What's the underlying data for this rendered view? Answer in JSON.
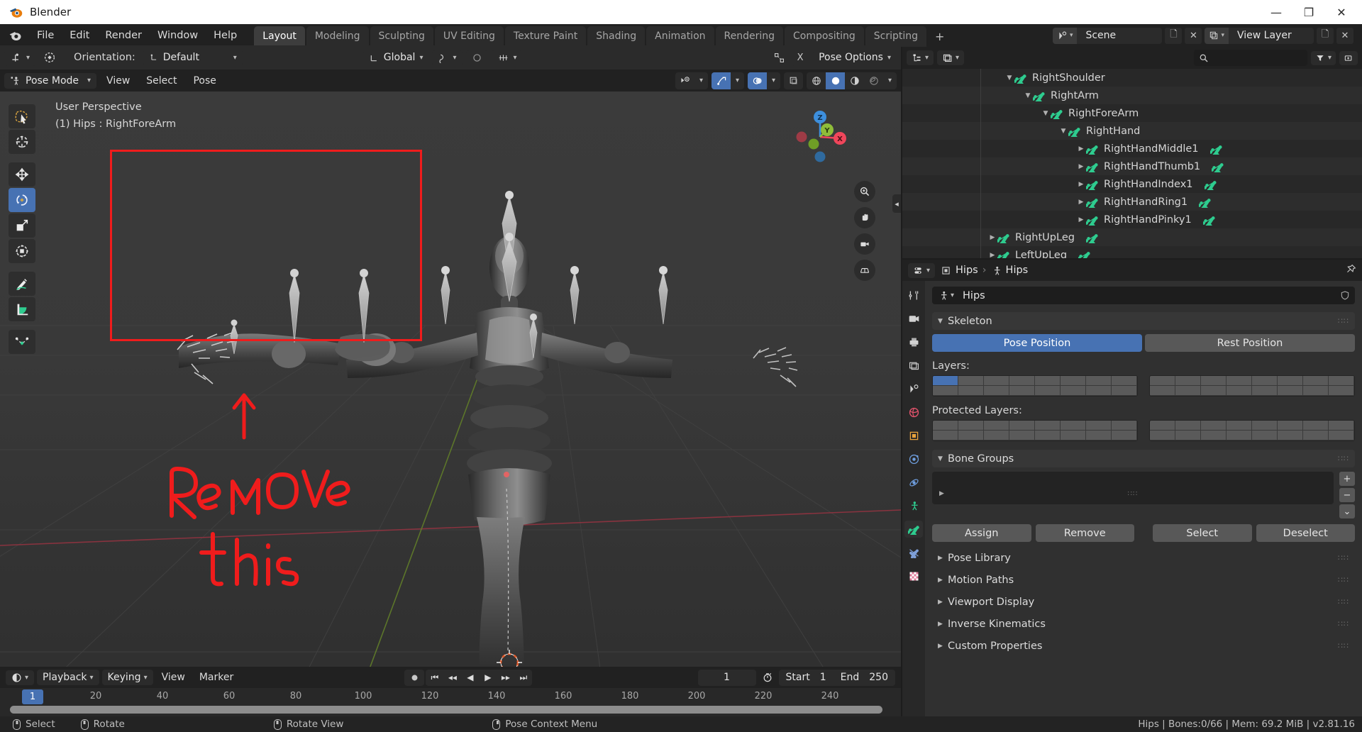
{
  "window": {
    "title": "Blender",
    "minimize": "—",
    "maximize": "❐",
    "close": "✕"
  },
  "topbar": {
    "menus": [
      "File",
      "Edit",
      "Render",
      "Window",
      "Help"
    ],
    "workspaces": [
      "Layout",
      "Modeling",
      "Sculpting",
      "UV Editing",
      "Texture Paint",
      "Shading",
      "Animation",
      "Rendering",
      "Compositing",
      "Scripting"
    ],
    "active_workspace": "Layout",
    "add_workspace": "+",
    "scene_name": "Scene",
    "view_layer_name": "View Layer"
  },
  "tool_settings": {
    "orientation_label": "Orientation:",
    "orientation_value": "Default",
    "transform_value": "Global",
    "proportional_x": "X",
    "pose_options": "Pose Options"
  },
  "viewport": {
    "mode": "Pose Mode",
    "menus": [
      "View",
      "Select",
      "Pose"
    ],
    "overlay_text_line1": "User Perspective",
    "overlay_text_line2": "(1) Hips : RightForeArm",
    "gizmo_axes": [
      {
        "label": "Z",
        "color": "#3d8fdd"
      },
      {
        "label": "Y",
        "color": "#8fbd3a"
      },
      {
        "label": "X",
        "color": "#f0465b"
      }
    ],
    "tools": [
      {
        "name": "tweak-tool",
        "active": false
      },
      {
        "name": "cursor-tool",
        "active": false
      },
      {
        "name": "move-tool",
        "active": false
      },
      {
        "name": "rotate-tool",
        "active": true
      },
      {
        "name": "scale-tool",
        "active": false
      },
      {
        "name": "transform-tool",
        "active": false
      },
      {
        "name": "annotate-tool",
        "active": false
      },
      {
        "name": "measure-tool",
        "active": false
      },
      {
        "name": "breakdowner-tool",
        "active": false
      }
    ],
    "annotation_text_line1": "ReMOVe",
    "annotation_text_line2": "this"
  },
  "outliner": {
    "search_placeholder": "",
    "rows": [
      {
        "label": "RightShoulder",
        "indent": 4,
        "expanded": true,
        "extra_bone": false,
        "clipped": true
      },
      {
        "label": "RightArm",
        "indent": 5,
        "expanded": true,
        "extra_bone": false,
        "clipped": false
      },
      {
        "label": "RightForeArm",
        "indent": 6,
        "expanded": true,
        "extra_bone": false,
        "clipped": false
      },
      {
        "label": "RightHand",
        "indent": 7,
        "expanded": true,
        "extra_bone": false,
        "clipped": false
      },
      {
        "label": "RightHandMiddle1",
        "indent": 8,
        "expanded": false,
        "extra_bone": true,
        "clipped": false
      },
      {
        "label": "RightHandThumb1",
        "indent": 8,
        "expanded": false,
        "extra_bone": true,
        "clipped": false
      },
      {
        "label": "RightHandIndex1",
        "indent": 8,
        "expanded": false,
        "extra_bone": true,
        "clipped": false
      },
      {
        "label": "RightHandRing1",
        "indent": 8,
        "expanded": false,
        "extra_bone": true,
        "clipped": false
      },
      {
        "label": "RightHandPinky1",
        "indent": 8,
        "expanded": false,
        "extra_bone": true,
        "clipped": false
      },
      {
        "label": "RightUpLeg",
        "indent": 4,
        "expanded": false,
        "extra_bone": true,
        "clipped": false
      },
      {
        "label": "LeftUpLeg",
        "indent": 4,
        "expanded": false,
        "extra_bone": true,
        "clipped": false
      }
    ]
  },
  "properties": {
    "breadcrumb_object": "Hips",
    "breadcrumb_data": "Hips",
    "name_value": "Hips",
    "panels": {
      "skeleton": {
        "title": "Skeleton",
        "pose_position": "Pose Position",
        "rest_position": "Rest Position",
        "layers_label": "Layers:",
        "protected_layers_label": "Protected Layers:",
        "active_layer_index": 0
      },
      "bone_groups": {
        "title": "Bone Groups",
        "add": "+",
        "remove": "−",
        "menu": "⌄",
        "assign": "Assign",
        "remove_btn": "Remove",
        "select": "Select",
        "deselect": "Deselect"
      },
      "collapsed": [
        "Pose Library",
        "Motion Paths",
        "Viewport Display",
        "Inverse Kinematics",
        "Custom Properties"
      ]
    }
  },
  "timeline": {
    "menus": [
      "View",
      "Marker"
    ],
    "playback": "Playback",
    "keying": "Keying",
    "current_frame": "1",
    "start_label": "Start",
    "start_value": "1",
    "end_label": "End",
    "end_value": "250",
    "ticks": [
      "20",
      "40",
      "60",
      "80",
      "100",
      "120",
      "140",
      "160",
      "180",
      "200",
      "220",
      "240"
    ],
    "playhead_label": "1"
  },
  "statusbar": {
    "items": [
      {
        "label": "Select",
        "button": "left"
      },
      {
        "label": "Rotate",
        "button": "left"
      },
      {
        "label": "Rotate View",
        "button": "middle"
      },
      {
        "label": "Pose Context Menu",
        "button": "right"
      }
    ],
    "info": "Hips | Bones:0/66  | Mem: 69.2 MiB | v2.81.16"
  },
  "colors": {
    "accent_blue": "#4772b3",
    "bone_green": "#2ecc8f",
    "annotation_red": "#ef1c1c",
    "axis_x": "#f0465b",
    "axis_y": "#8fbd3a",
    "axis_z": "#3d8fdd"
  }
}
